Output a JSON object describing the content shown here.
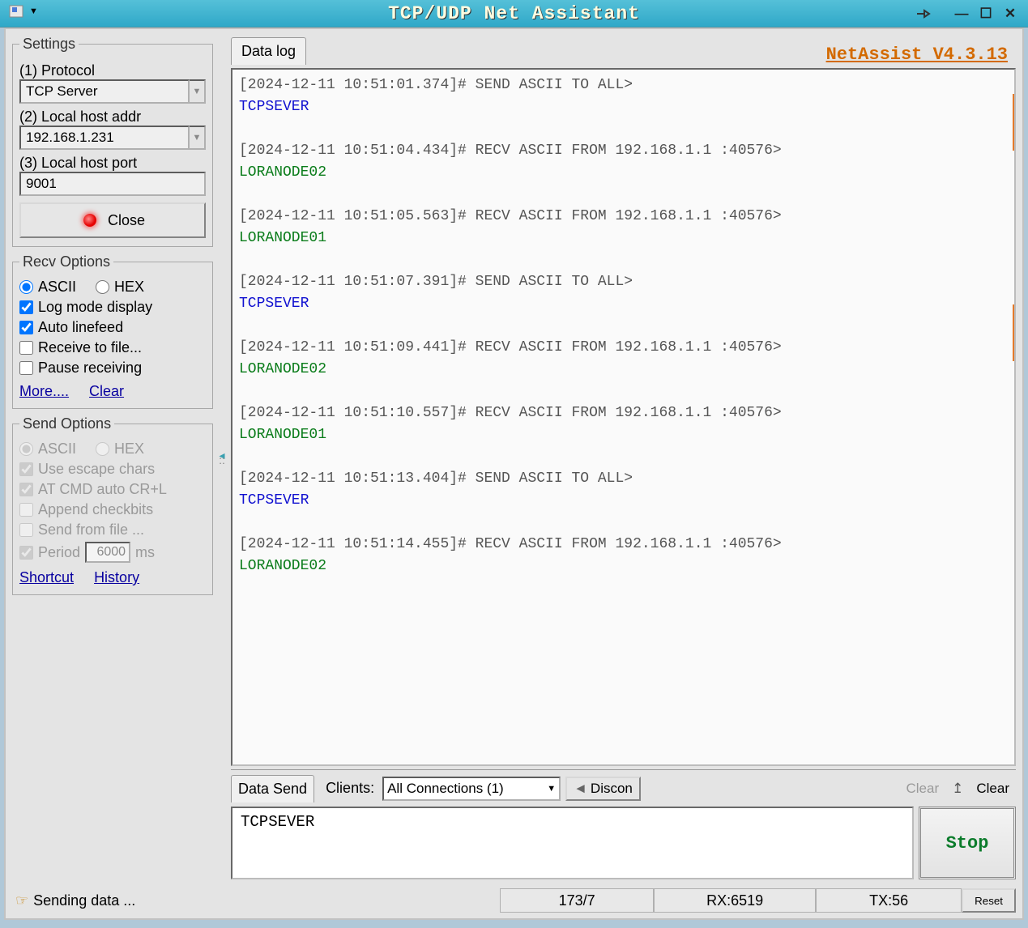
{
  "title": "TCP/UDP Net Assistant",
  "brand": "NetAssist V4.3.13",
  "settings": {
    "legend": "Settings",
    "protocol_label": "(1) Protocol",
    "protocol_value": "TCP Server",
    "addr_label": "(2) Local host addr",
    "addr_value": "192.168.1.231",
    "port_label": "(3) Local host port",
    "port_value": "9001",
    "close_btn": "Close"
  },
  "recv": {
    "legend": "Recv Options",
    "ascii": "ASCII",
    "hex": "HEX",
    "logmode": "Log mode display",
    "autolf": "Auto linefeed",
    "tofile": "Receive to file...",
    "pause": "Pause receiving",
    "more": "More....",
    "clear": "Clear"
  },
  "send": {
    "legend": "Send Options",
    "ascii": "ASCII",
    "hex": "HEX",
    "escape": "Use escape chars",
    "atcmd": "AT CMD auto CR+L",
    "append": "Append checkbits",
    "fromfile": "Send from file ...",
    "period": "Period",
    "period_val": "6000",
    "period_unit": "ms",
    "shortcut": "Shortcut",
    "history": "History"
  },
  "tabs": {
    "datalog": "Data log",
    "datasend": "Data Send"
  },
  "log_entries": [
    {
      "header": "[2024-12-11 10:51:01.374]# SEND ASCII TO ALL>",
      "body": "TCPSEVER",
      "color": "blue"
    },
    {
      "header": "[2024-12-11 10:51:04.434]# RECV ASCII FROM 192.168.1.1 :40576>",
      "body": "LORANODE02",
      "color": "green"
    },
    {
      "header": "[2024-12-11 10:51:05.563]# RECV ASCII FROM 192.168.1.1 :40576>",
      "body": "LORANODE01",
      "color": "green"
    },
    {
      "header": "[2024-12-11 10:51:07.391]# SEND ASCII TO ALL>",
      "body": "TCPSEVER",
      "color": "blue"
    },
    {
      "header": "[2024-12-11 10:51:09.441]# RECV ASCII FROM 192.168.1.1 :40576>",
      "body": "LORANODE02",
      "color": "green"
    },
    {
      "header": "[2024-12-11 10:51:10.557]# RECV ASCII FROM 192.168.1.1 :40576>",
      "body": "LORANODE01",
      "color": "green"
    },
    {
      "header": "[2024-12-11 10:51:13.404]# SEND ASCII TO ALL>",
      "body": "TCPSEVER",
      "color": "blue"
    },
    {
      "header": "[2024-12-11 10:51:14.455]# RECV ASCII FROM 192.168.1.1 :40576>",
      "body": "LORANODE02",
      "color": "green"
    }
  ],
  "sendbar": {
    "clients_label": "Clients:",
    "clients_value": "All Connections (1)",
    "discon": "Discon",
    "clear_dim": "Clear",
    "clear": "Clear"
  },
  "sendinput": "TCPSEVER",
  "stop_btn": "Stop",
  "status": {
    "leading": "Sending data ...",
    "ratio": "173/7",
    "rx": "RX:6519",
    "tx": "TX:56",
    "reset": "Reset"
  }
}
